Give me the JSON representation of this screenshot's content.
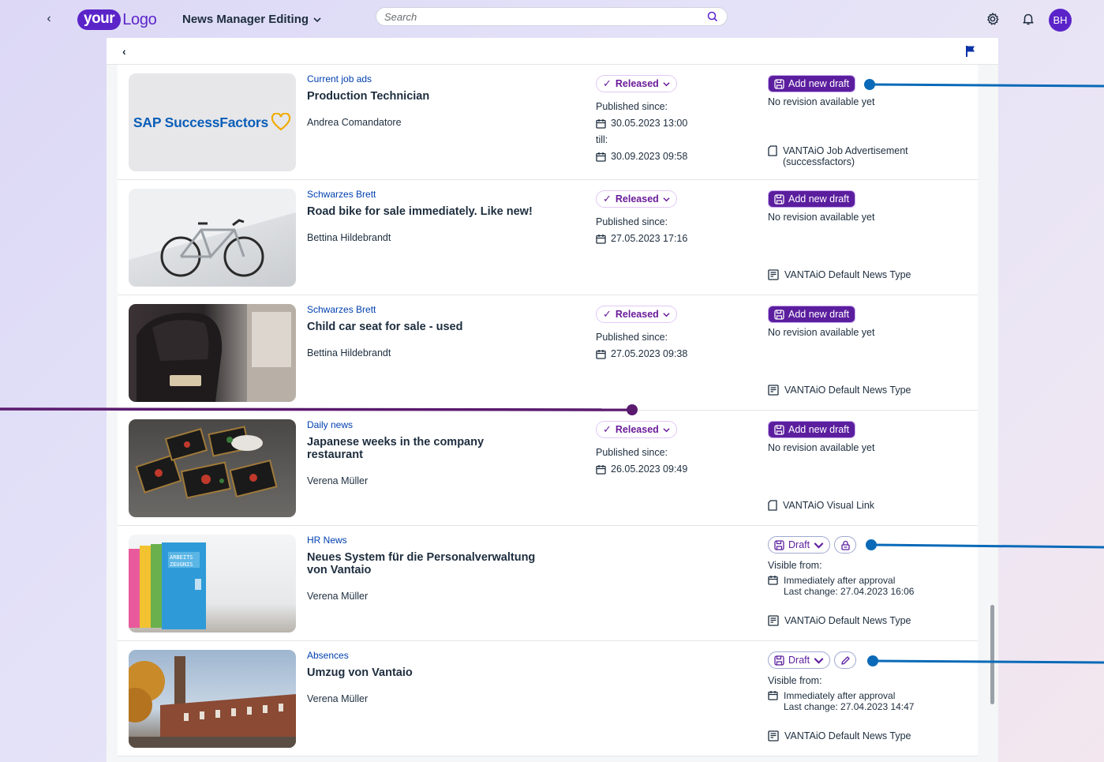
{
  "shell": {
    "title": "News Manager Editing",
    "logo_part1": "your",
    "logo_part2": "Logo",
    "search_placeholder": "Search",
    "avatar_initials": "BH"
  },
  "labels": {
    "published_since": "Published since:",
    "till": "till:",
    "no_revision": "No revision available yet",
    "add_new_draft": "Add new draft",
    "released": "Released",
    "draft": "Draft",
    "visible_from": "Visible from:",
    "immediately": "Immediately after approval"
  },
  "thumb1_text": "SAP SuccessFactors",
  "items": [
    {
      "category": "Current job ads",
      "title": "Production Technician",
      "author": "Andrea Comandatore",
      "status": "Released",
      "published_since": "30.05.2023 13:00",
      "till": "30.09.2023 09:58",
      "type": "VANTAiO Job Advertisement (successfactors)"
    },
    {
      "category": "Schwarzes Brett",
      "title": "Road bike for sale immediately. Like new!",
      "author": "Bettina Hildebrandt",
      "status": "Released",
      "published_since": "27.05.2023 17:16",
      "type": "VANTAiO Default News Type"
    },
    {
      "category": "Schwarzes Brett",
      "title": "Child car seat for sale - used",
      "author": "Bettina Hildebrandt",
      "status": "Released",
      "published_since": "27.05.2023 09:38",
      "type": "VANTAiO Default News Type"
    },
    {
      "category": "Daily news",
      "title": "Japanese weeks in the company restaurant",
      "author": "Verena Müller",
      "status": "Released",
      "published_since": "26.05.2023 09:49",
      "type": "VANTAiO Visual Link"
    },
    {
      "category": "HR News",
      "title": "Neues System für die Personalverwaltung von Vantaio",
      "author": "Verena Müller",
      "status": "Draft",
      "last_change": "Last change: 27.04.2023 16:06",
      "type": "VANTAiO Default News Type"
    },
    {
      "category": "Absences",
      "title": "Umzug von Vantaio",
      "author": "Verena Müller",
      "status": "Draft",
      "last_change": "Last change: 27.04.2023 14:47",
      "type": "VANTAiO Default News Type"
    }
  ],
  "colors": {
    "brand": "#5b24c9",
    "primary_button": "#5b1e9e",
    "annotation_blue": "#0a6ab8",
    "annotation_purple": "#5a1a6e"
  },
  "icons": [
    "back-icon",
    "chevron-down-icon",
    "search-icon",
    "gear-icon",
    "bell-icon",
    "flag-icon",
    "calendar-icon",
    "draft-icon",
    "document-icon",
    "news-icon",
    "lock-icon",
    "pencil-icon",
    "checkmark-icon"
  ]
}
